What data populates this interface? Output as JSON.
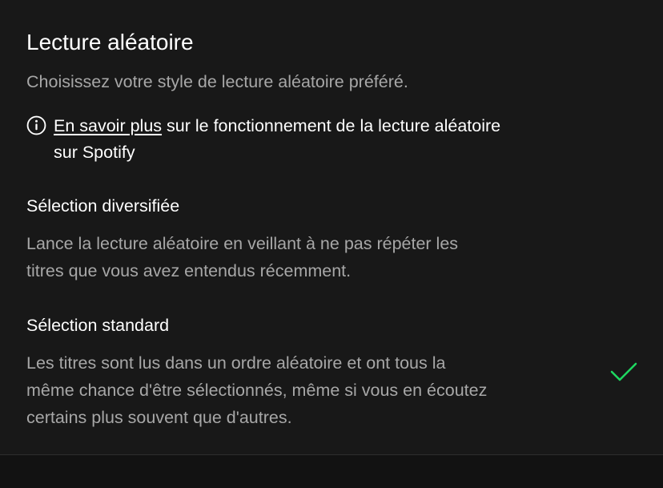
{
  "header": {
    "title": "Lecture aléatoire",
    "subtitle": "Choisissez votre style de lecture aléatoire préféré."
  },
  "info": {
    "icon": "info-icon",
    "link_text": "En savoir plus",
    "text_line1": " sur le fonctionnement de la lecture aléatoire",
    "text_line2": "sur Spotify"
  },
  "options": [
    {
      "label": "Sélection diversifiée",
      "desc_line1": "Lance la lecture aléatoire en veillant à ne pas répéter les",
      "desc_line2": "titres que vous avez entendus récemment.",
      "selected": false
    },
    {
      "label": "Sélection standard",
      "desc_line1": "Les titres sont lus dans un ordre aléatoire et ont tous la",
      "desc_line2": "même chance d'être sélectionnés, même si vous en écoutez",
      "desc_line3": "certains plus souvent que d'autres.",
      "selected": true
    }
  ],
  "colors": {
    "accent": "#1ed760",
    "background": "#181818",
    "secondary_text": "#a7a7a7"
  }
}
